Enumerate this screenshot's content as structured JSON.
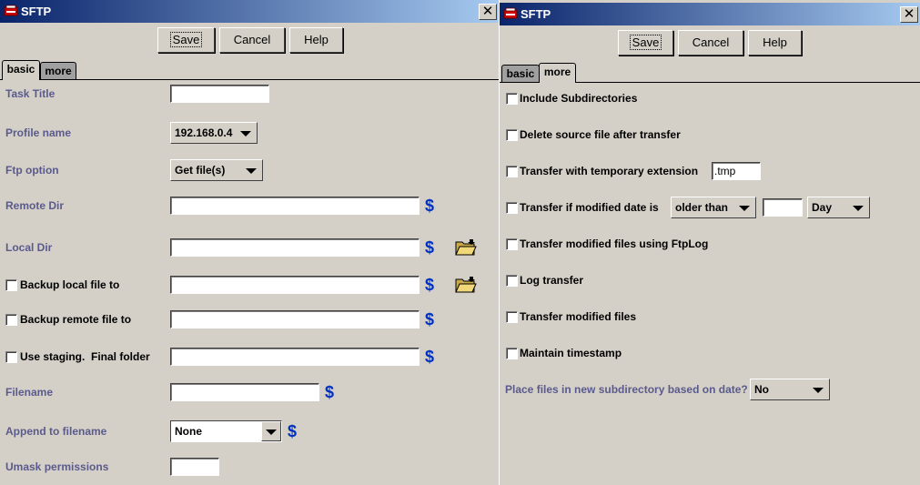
{
  "left": {
    "title": "SFTP",
    "close": "✕",
    "buttons": {
      "save": "Save",
      "cancel": "Cancel",
      "help": "Help"
    },
    "tabs": {
      "basic": "basic",
      "more": "more"
    },
    "task_title": {
      "label": "Task Title",
      "value": ""
    },
    "profile_name": {
      "label": "Profile name",
      "value": "192.168.0.4"
    },
    "ftp_option": {
      "label": "Ftp option",
      "value": "Get file(s)"
    },
    "remote_dir": {
      "label": "Remote Dir",
      "value": "",
      "var": "$"
    },
    "local_dir": {
      "label": "Local Dir",
      "value": "",
      "var": "$"
    },
    "backup_local": {
      "label": "Backup local file to",
      "value": "",
      "var": "$",
      "checked": false
    },
    "backup_remote": {
      "label": "Backup remote file to",
      "value": "",
      "var": "$",
      "checked": false
    },
    "staging": {
      "label": "Use staging.  Final folder",
      "value": "",
      "var": "$",
      "checked": false
    },
    "filename": {
      "label": "Filename",
      "value": "",
      "var": "$"
    },
    "append": {
      "label": "Append to filename",
      "value": "None",
      "var": "$"
    },
    "umask": {
      "label": "Umask permissions",
      "value": ""
    }
  },
  "right": {
    "title": "SFTP",
    "close": "✕",
    "buttons": {
      "save": "Save",
      "cancel": "Cancel",
      "help": "Help"
    },
    "tabs": {
      "basic": "basic",
      "more": "more"
    },
    "include_subdirs": {
      "label": "Include Subdirectories",
      "checked": false
    },
    "delete_source": {
      "label": "Delete source file after transfer",
      "checked": false
    },
    "temp_ext": {
      "label": "Transfer with temporary extension",
      "value": ".tmp",
      "checked": false
    },
    "modified_date": {
      "label": "Transfer if modified date is",
      "op": "older than",
      "amount": "",
      "unit": "Day",
      "checked": false
    },
    "ftplog": {
      "label": "Transfer modified files using FtpLog",
      "checked": false
    },
    "log_transfer": {
      "label": "Log transfer",
      "checked": false
    },
    "modified_files": {
      "label": "Transfer modified files",
      "checked": false
    },
    "timestamp": {
      "label": "Maintain timestamp",
      "checked": false
    },
    "subdir_date": {
      "label": "Place files in new subdirectory based on date?",
      "value": "No"
    }
  },
  "colors": {
    "titlebar_start": "#0a246a",
    "titlebar_end": "#a6caf0",
    "label": "#5a5a8c",
    "variable": "#0030c0",
    "window": "#d4d0c8"
  }
}
